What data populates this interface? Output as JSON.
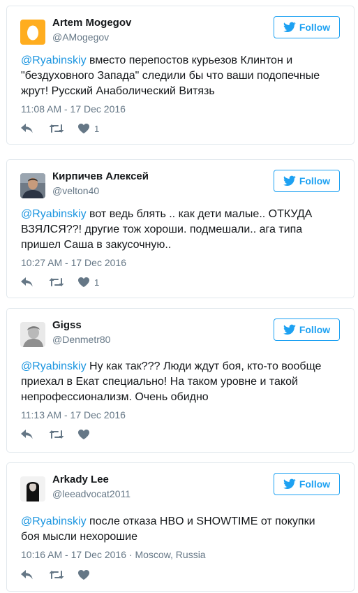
{
  "colors": {
    "accent": "#1da1f2",
    "mention": "#1b95e0",
    "muted": "#657786",
    "border": "#e1e8ed"
  },
  "follow_label": "Follow",
  "tweets": [
    {
      "name": "Artem Mogegov",
      "handle": "@AMogegov",
      "mention": "@Ryabinskiy",
      "body": " вместо перепостов курьезов Клинтон и \"бездуховного Запада\" следили бы что ваши подопечные жрут! Русский Анаболический Витязь",
      "timestamp": "11:08 AM - 17 Dec 2016",
      "like_count": "1",
      "avatar": "egg-avatar"
    },
    {
      "name": "Кирпичев Алексей",
      "handle": "@velton40",
      "mention": "@Ryabinskiy",
      "body": " вот ведь блять .. как дети малые.. ОТКУДА ВЗЯЛСЯ??! другие тож хороши. подмешали.. ага типа пришел Саша в закусочную..",
      "timestamp": "10:27 AM - 17 Dec 2016",
      "like_count": "1",
      "avatar": "photo-avatar"
    },
    {
      "name": "Gigss",
      "handle": "@Denmetr80",
      "mention": "@Ryabinskiy",
      "body": " Ну как так??? Люди ждут боя, кто-то вообще приехал в Екат специально! На таком уровне и такой непрофессионализм. Очень обидно",
      "timestamp": "11:13 AM - 17 Dec 2016",
      "like_count": "",
      "avatar": "sketch-avatar"
    },
    {
      "name": "Arkady Lee",
      "handle": "@leeadvocat2011",
      "mention": "@Ryabinskiy",
      "body": " после отказа HBO и SHOWTIME от покупки боя мысли нехорошие",
      "timestamp": "10:16 AM - 17 Dec 2016",
      "location": "Moscow, Russia",
      "like_count": "",
      "avatar": "dark-avatar"
    }
  ]
}
